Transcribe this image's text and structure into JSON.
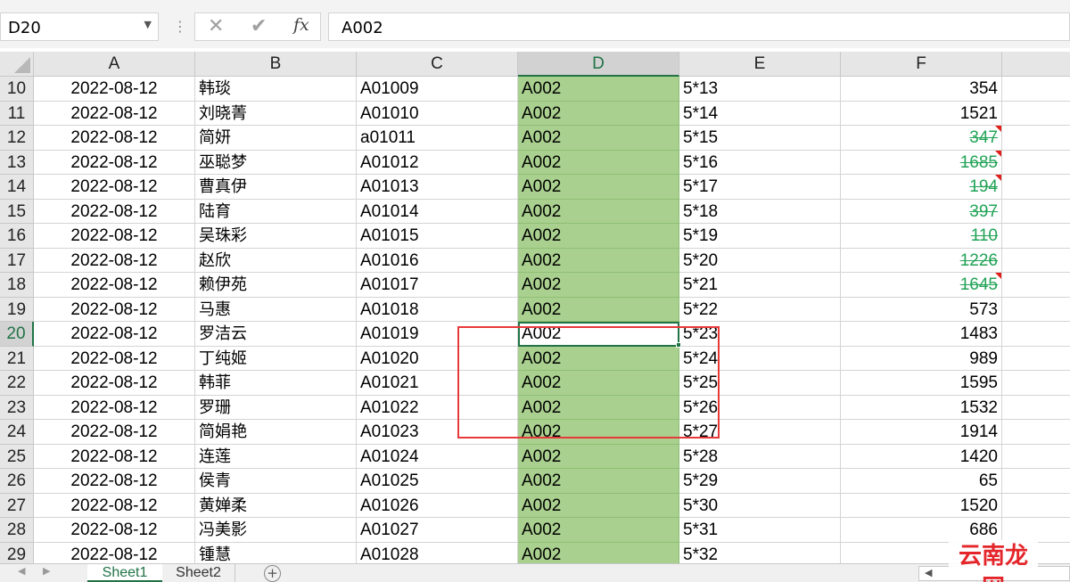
{
  "name_box": {
    "value": "D20"
  },
  "formula_bar": {
    "value": "A002",
    "cancel_icon": "✕",
    "enter_icon": "✔",
    "fx_label": "fx"
  },
  "columns": [
    {
      "id": "A",
      "label": "A"
    },
    {
      "id": "B",
      "label": "B"
    },
    {
      "id": "C",
      "label": "C"
    },
    {
      "id": "D",
      "label": "D"
    },
    {
      "id": "E",
      "label": "E"
    },
    {
      "id": "F",
      "label": "F"
    }
  ],
  "selected_cell": "D20",
  "colors": {
    "accent": "#217346",
    "highlight_fill": "#a9d08e",
    "strike_text": "#22a357",
    "annotation_box": "#e8393a",
    "comment_marker": "#e0201b"
  },
  "rows": [
    {
      "num": "10",
      "a": "2022-08-12",
      "b": "韩琰",
      "c": "A01009",
      "d": "A002",
      "e": "5*13",
      "f": "354",
      "f_strike": false,
      "comment": false
    },
    {
      "num": "11",
      "a": "2022-08-12",
      "b": "刘晓菁",
      "c": "A01010",
      "d": "A002",
      "e": "5*14",
      "f": "1521",
      "f_strike": false,
      "comment": false
    },
    {
      "num": "12",
      "a": "2022-08-12",
      "b": "简妍",
      "c": "a01011",
      "d": "A002",
      "e": "5*15",
      "f": "347",
      "f_strike": true,
      "comment": true
    },
    {
      "num": "13",
      "a": "2022-08-12",
      "b": "巫聪梦",
      "c": "A01012",
      "d": "A002",
      "e": "5*16",
      "f": "1685",
      "f_strike": true,
      "comment": true
    },
    {
      "num": "14",
      "a": "2022-08-12",
      "b": "曹真伊",
      "c": "A01013",
      "d": "A002",
      "e": "5*17",
      "f": "194",
      "f_strike": true,
      "comment": true
    },
    {
      "num": "15",
      "a": "2022-08-12",
      "b": "陆育",
      "c": "A01014",
      "d": "A002",
      "e": "5*18",
      "f": "397",
      "f_strike": true,
      "comment": false
    },
    {
      "num": "16",
      "a": "2022-08-12",
      "b": "吴珠彩",
      "c": "A01015",
      "d": "A002",
      "e": "5*19",
      "f": "110",
      "f_strike": true,
      "comment": false
    },
    {
      "num": "17",
      "a": "2022-08-12",
      "b": "赵欣",
      "c": "A01016",
      "d": "A002",
      "e": "5*20",
      "f": "1226",
      "f_strike": true,
      "comment": false
    },
    {
      "num": "18",
      "a": "2022-08-12",
      "b": "赖伊苑",
      "c": "A01017",
      "d": "A002",
      "e": "5*21",
      "f": "1645",
      "f_strike": true,
      "comment": true
    },
    {
      "num": "19",
      "a": "2022-08-12",
      "b": "马惠",
      "c": "A01018",
      "d": "A002",
      "e": "5*22",
      "f": "573",
      "f_strike": false,
      "comment": false
    },
    {
      "num": "20",
      "a": "2022-08-12",
      "b": "罗洁云",
      "c": "A01019",
      "d": "A002",
      "e": "5*23",
      "f": "1483",
      "f_strike": false,
      "comment": false
    },
    {
      "num": "21",
      "a": "2022-08-12",
      "b": "丁纯姬",
      "c": "A01020",
      "d": "A002",
      "e": "5*24",
      "f": "989",
      "f_strike": false,
      "comment": false
    },
    {
      "num": "22",
      "a": "2022-08-12",
      "b": "韩菲",
      "c": "A01021",
      "d": "A002",
      "e": "5*25",
      "f": "1595",
      "f_strike": false,
      "comment": false
    },
    {
      "num": "23",
      "a": "2022-08-12",
      "b": "罗珊",
      "c": "A01022",
      "d": "A002",
      "e": "5*26",
      "f": "1532",
      "f_strike": false,
      "comment": false
    },
    {
      "num": "24",
      "a": "2022-08-12",
      "b": "简娟艳",
      "c": "A01023",
      "d": "A002",
      "e": "5*27",
      "f": "1914",
      "f_strike": false,
      "comment": false
    },
    {
      "num": "25",
      "a": "2022-08-12",
      "b": "连莲",
      "c": "A01024",
      "d": "A002",
      "e": "5*28",
      "f": "1420",
      "f_strike": false,
      "comment": false
    },
    {
      "num": "26",
      "a": "2022-08-12",
      "b": "侯青",
      "c": "A01025",
      "d": "A002",
      "e": "5*29",
      "f": "65",
      "f_strike": false,
      "comment": false
    },
    {
      "num": "27",
      "a": "2022-08-12",
      "b": "黄婵柔",
      "c": "A01026",
      "d": "A002",
      "e": "5*30",
      "f": "1520",
      "f_strike": false,
      "comment": false
    },
    {
      "num": "28",
      "a": "2022-08-12",
      "b": "冯美影",
      "c": "A01027",
      "d": "A002",
      "e": "5*31",
      "f": "686",
      "f_strike": false,
      "comment": false
    },
    {
      "num": "29",
      "a": "2022-08-12",
      "b": "锺慧",
      "c": "A01028",
      "d": "A002",
      "e": "5*32",
      "f": "",
      "f_strike": false,
      "comment": false
    }
  ],
  "sheets": [
    {
      "label": "Sheet1",
      "active": true
    },
    {
      "label": "Sheet2",
      "active": false
    }
  ],
  "add_sheet_icon": "+",
  "watermark": "云南龙网"
}
